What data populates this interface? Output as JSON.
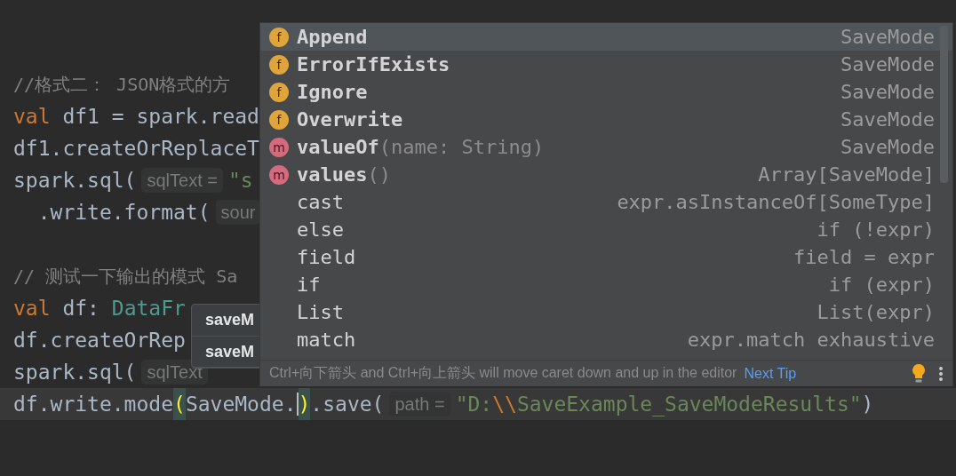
{
  "editor": {
    "lines": [
      {
        "current": false
      },
      {
        "current": false
      },
      {
        "current": false,
        "segments": [
          {
            "kind": "comment",
            "text": "//格式二： JSON格式的方"
          }
        ]
      },
      {
        "current": false,
        "segments": [
          {
            "kind": "keyword",
            "text": "val"
          },
          {
            "kind": "plain",
            "text": " df1 = spark.read"
          }
        ]
      },
      {
        "current": false,
        "segments": [
          {
            "kind": "plain",
            "text": "df1.createOrReplaceT"
          }
        ]
      },
      {
        "current": false,
        "segments": [
          {
            "kind": "plain",
            "text": "spark.sql("
          },
          {
            "kind": "hint",
            "text": "sqlText ="
          },
          {
            "kind": "string",
            "text": "\"s"
          }
        ]
      },
      {
        "current": false,
        "segments": [
          {
            "kind": "plain",
            "text": "  .write.format("
          },
          {
            "kind": "hint",
            "text": "sour"
          }
        ]
      },
      {
        "current": false
      },
      {
        "current": false,
        "segments": [
          {
            "kind": "comment",
            "text": "// 测试一下输出的模式 Sa"
          }
        ]
      },
      {
        "current": false,
        "segments": [
          {
            "kind": "keyword",
            "text": "val"
          },
          {
            "kind": "plain",
            "text": " df: "
          },
          {
            "kind": "type",
            "text": "DataFr"
          }
        ]
      },
      {
        "current": false,
        "segments": [
          {
            "kind": "plain",
            "text": "df.createOrRep"
          }
        ]
      },
      {
        "current": false,
        "segments": [
          {
            "kind": "plain",
            "text": "spark.sql("
          },
          {
            "kind": "hint",
            "text": "sqlText"
          }
        ]
      },
      {
        "current": true,
        "segments": [
          {
            "kind": "plain",
            "text": "df.write.mode"
          },
          {
            "kind": "bracket",
            "text": "("
          },
          {
            "kind": "plain",
            "text": "SaveMode."
          },
          {
            "kind": "caret"
          },
          {
            "kind": "bracket",
            "text": ")"
          },
          {
            "kind": "plain",
            "text": ".save("
          },
          {
            "kind": "hint",
            "text": "path ="
          },
          {
            "kind": "string",
            "text": "\"D:"
          },
          {
            "kind": "escape",
            "text": "\\\\"
          },
          {
            "kind": "string",
            "text": "SaveExample_SaveModeResults\""
          },
          {
            "kind": "plain",
            "text": ")"
          }
        ]
      }
    ]
  },
  "small_popup": {
    "items": [
      "saveM",
      "saveM"
    ]
  },
  "completion_popup": {
    "items": [
      {
        "kind": "field",
        "icon": "f",
        "name": "Append",
        "bold": true,
        "selected": true,
        "type": "SaveMode"
      },
      {
        "kind": "field",
        "icon": "f",
        "name": "ErrorIfExists",
        "bold": true,
        "selected": false,
        "type": "SaveMode"
      },
      {
        "kind": "field",
        "icon": "f",
        "name": "Ignore",
        "bold": true,
        "selected": false,
        "type": "SaveMode"
      },
      {
        "kind": "field",
        "icon": "f",
        "name": "Overwrite",
        "bold": true,
        "selected": false,
        "type": "SaveMode"
      },
      {
        "kind": "method",
        "icon": "m",
        "name": "valueOf",
        "params": "(name: String)",
        "bold": true,
        "selected": false,
        "type": "SaveMode"
      },
      {
        "kind": "method",
        "icon": "m",
        "name": "values",
        "params": "()",
        "bold": true,
        "selected": false,
        "type": "Array[SaveMode]"
      },
      {
        "kind": "template",
        "name": "cast",
        "bold": false,
        "selected": false,
        "type": "expr.asInstanceOf[SomeType]"
      },
      {
        "kind": "template",
        "name": "else",
        "bold": false,
        "selected": false,
        "type": "if (!expr)"
      },
      {
        "kind": "template",
        "name": "field",
        "bold": false,
        "selected": false,
        "type": "field = expr"
      },
      {
        "kind": "template",
        "name": "if",
        "bold": false,
        "selected": false,
        "type": "if (expr)"
      },
      {
        "kind": "template",
        "name": "List",
        "bold": false,
        "selected": false,
        "type": "List(expr)"
      },
      {
        "kind": "template",
        "name": "match",
        "bold": false,
        "selected": false,
        "type": "expr.match exhaustive"
      }
    ],
    "tip": {
      "text": "Ctrl+向下箭头 and Ctrl+向上箭头 will move caret down and up in the editor",
      "link": "Next Tip"
    }
  }
}
